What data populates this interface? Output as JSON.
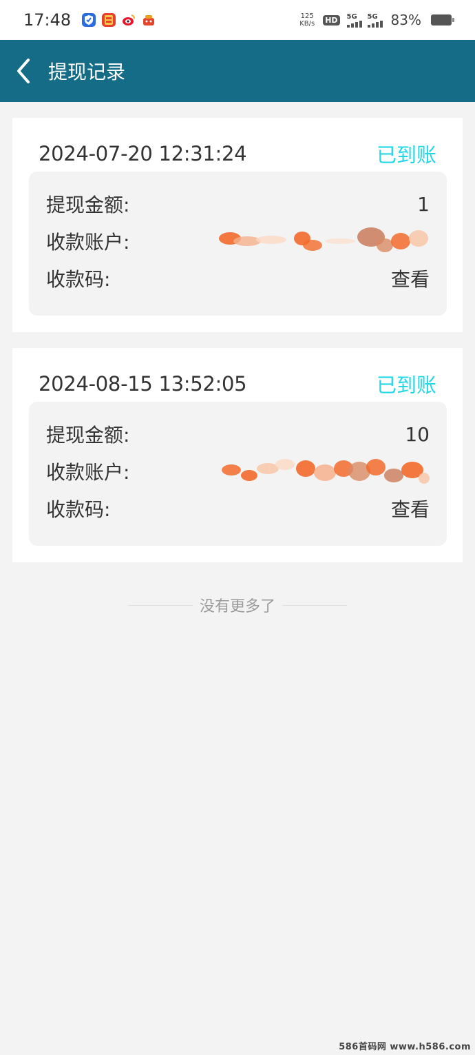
{
  "status_bar": {
    "time": "17:48",
    "net_speed_value": "125",
    "net_speed_unit": "KB/s",
    "hd_label": "HD",
    "signal1_label": "5G",
    "signal2_label": "5G",
    "battery_percent": "83%",
    "app_icons": [
      "shield-app-icon",
      "red-envelope-app-icon",
      "weibo-app-icon",
      "gift-bag-app-icon"
    ]
  },
  "header": {
    "title": "提现记录"
  },
  "records": [
    {
      "time": "2024-07-20 12:31:24",
      "status": "已到账",
      "amount_label": "提现金额:",
      "amount_value": "1",
      "account_label": "收款账户:",
      "code_label": "收款码:",
      "code_action": "查看"
    },
    {
      "time": "2024-08-15 13:52:05",
      "status": "已到账",
      "amount_label": "提现金额:",
      "amount_value": "10",
      "account_label": "收款账户:",
      "code_label": "收款码:",
      "code_action": "查看"
    }
  ],
  "footer": {
    "no_more_text": "没有更多了"
  },
  "watermark": "586首码网 www.h586.com",
  "colors": {
    "header_bg": "#146c87",
    "status_received": "#23d7e6",
    "page_bg": "#f3f3f3",
    "mask_orange": "#f26a2b"
  }
}
